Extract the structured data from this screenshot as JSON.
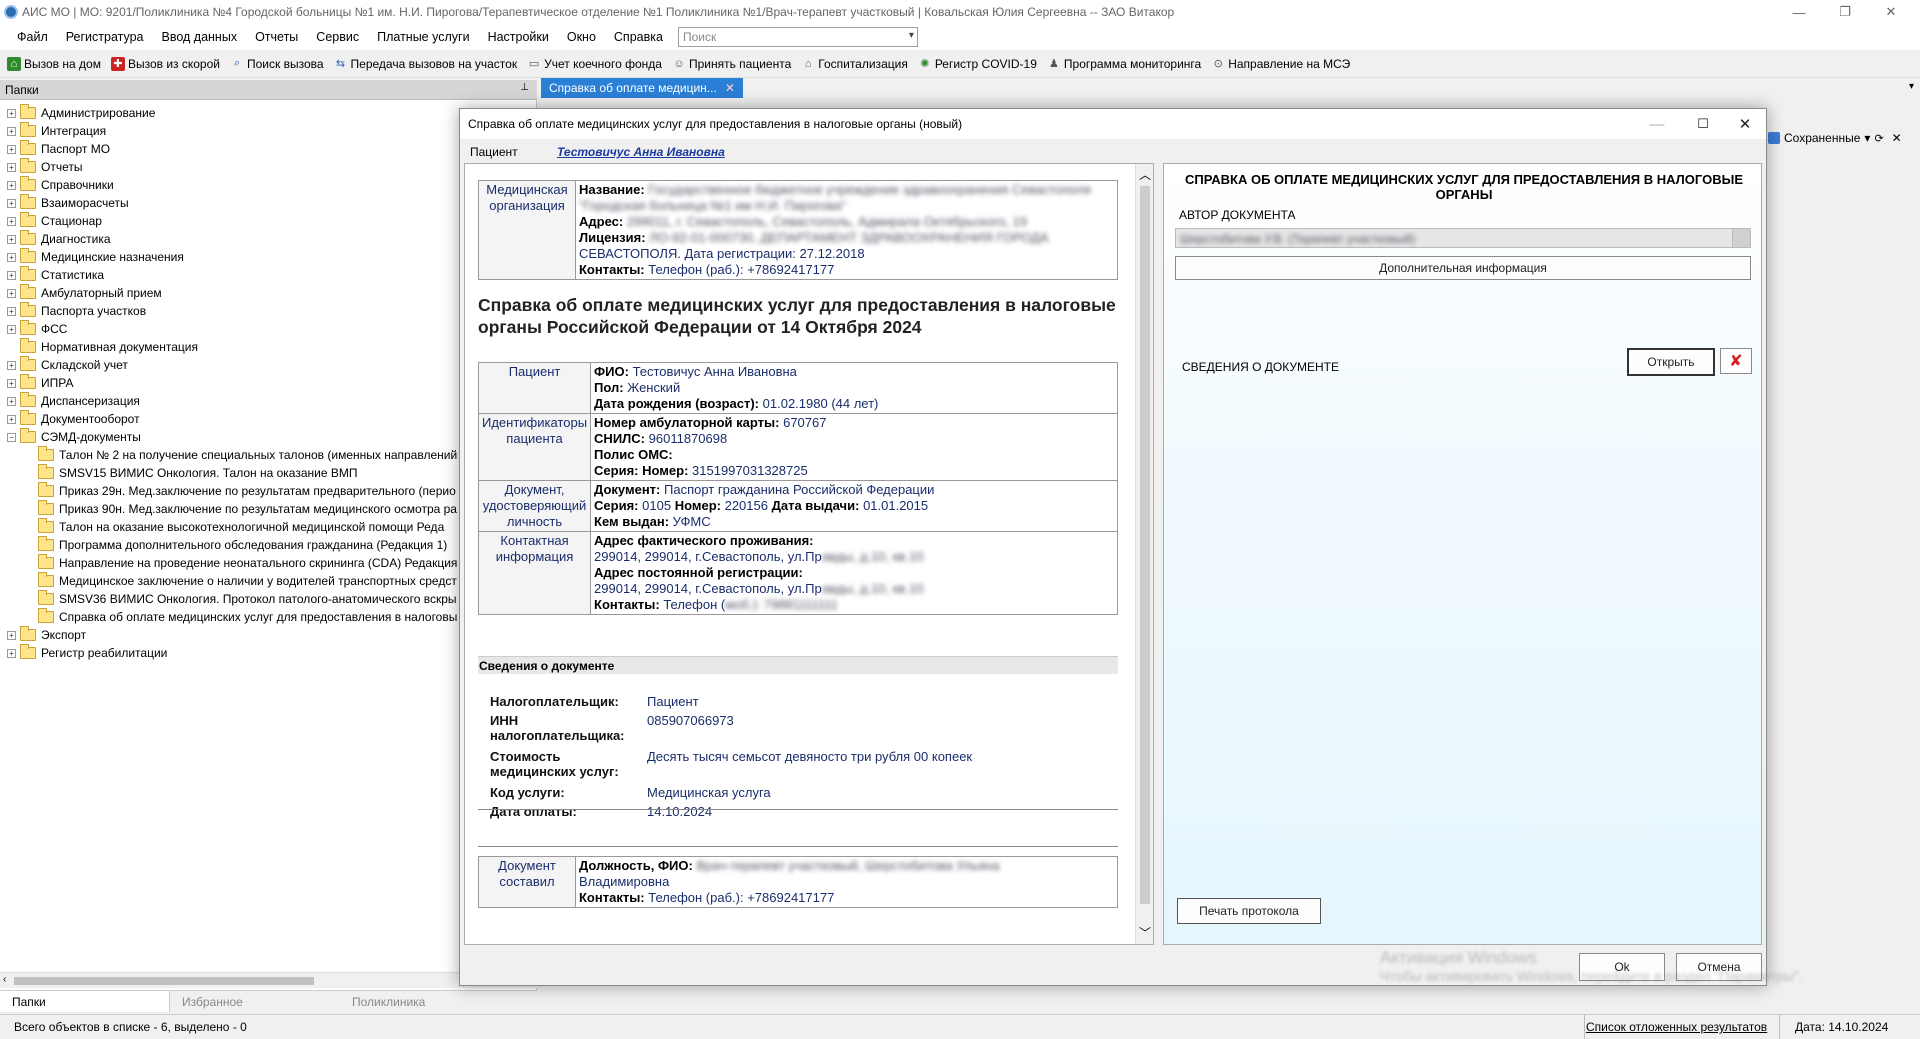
{
  "window": {
    "title": "АИС МО | МО: 9201/Поликлиника №4 Городской больницы №1 им. Н.И. Пирогова/Терапевтическое отделение №1 Поликлиника №1/Врач-терапевт участковый | Ковальская Юлия Сергеевна -- ЗАО Витакор"
  },
  "menu": [
    "Файл",
    "Регистратура",
    "Ввод данных",
    "Отчеты",
    "Сервис",
    "Платные услуги",
    "Настройки",
    "Окно",
    "Справка"
  ],
  "search": {
    "placeholder": "Поиск"
  },
  "toolbar": [
    {
      "label": "Вызов на дом",
      "icon": "house-icon",
      "color": "#2e8b2e"
    },
    {
      "label": "Вызов из скорой",
      "icon": "ambulance-icon",
      "color": "#cc2222"
    },
    {
      "label": "Поиск вызова",
      "icon": "search-icon",
      "color": "#2b5fb0"
    },
    {
      "label": "Передача вызовов на участок",
      "icon": "transfer-icon",
      "color": "#2b5fb0"
    },
    {
      "label": "Учет коечного фонда",
      "icon": "bed-icon",
      "color": "#555555"
    },
    {
      "label": "Принять пациента",
      "icon": "patient-icon",
      "color": "#555555"
    },
    {
      "label": "Госпитализация",
      "icon": "hospital-icon",
      "color": "#555555"
    },
    {
      "label": "Регистр COVID-19",
      "icon": "virus-icon",
      "color": "#2e8b2e"
    },
    {
      "label": "Программа мониторинга",
      "icon": "monitor-icon",
      "color": "#555555"
    },
    {
      "label": "Направление на МСЭ",
      "icon": "referral-icon",
      "color": "#555555"
    }
  ],
  "left_panel": {
    "header": "Папки",
    "pin": "📌",
    "tree": [
      {
        "label": "Администрирование",
        "level": 0,
        "expander": "+"
      },
      {
        "label": "Интеграция",
        "level": 0,
        "expander": "+"
      },
      {
        "label": "Паспорт МО",
        "level": 0,
        "expander": "+"
      },
      {
        "label": "Отчеты",
        "level": 0,
        "expander": "+"
      },
      {
        "label": "Справочники",
        "level": 0,
        "expander": "+"
      },
      {
        "label": "Взаиморасчеты",
        "level": 0,
        "expander": "+"
      },
      {
        "label": "Стационар",
        "level": 0,
        "expander": "+"
      },
      {
        "label": "Диагностика",
        "level": 0,
        "expander": "+"
      },
      {
        "label": "Медицинские назначения",
        "level": 0,
        "expander": "+"
      },
      {
        "label": "Статистика",
        "level": 0,
        "expander": "+"
      },
      {
        "label": "Амбулаторный прием",
        "level": 0,
        "expander": "+"
      },
      {
        "label": "Паспорта участков",
        "level": 0,
        "expander": "+"
      },
      {
        "label": "ФСС",
        "level": 0,
        "expander": "+"
      },
      {
        "label": "Нормативная документация",
        "level": 0,
        "expander": ""
      },
      {
        "label": "Складской учет",
        "level": 0,
        "expander": "+"
      },
      {
        "label": "ИПРА",
        "level": 0,
        "expander": "+"
      },
      {
        "label": "Диспансеризация",
        "level": 0,
        "expander": "+"
      },
      {
        "label": "Документооборот",
        "level": 0,
        "expander": "+"
      },
      {
        "label": "СЭМД-документы",
        "level": 0,
        "expander": "−"
      },
      {
        "label": "Талон № 2 на получение специальных талонов (именных направлений",
        "level": 1,
        "expander": ""
      },
      {
        "label": "SMSV15 ВИМИС Онкология. Талон на оказание ВМП",
        "level": 1,
        "expander": ""
      },
      {
        "label": "Приказ 29н. Мед.заключение по результатам предварительного (перио",
        "level": 1,
        "expander": ""
      },
      {
        "label": "Приказ 90н. Мед.заключение по результатам медицинского осмотра ра",
        "level": 1,
        "expander": ""
      },
      {
        "label": "Талон на оказание высокотехнологичной медицинской помощи Реда",
        "level": 1,
        "expander": ""
      },
      {
        "label": "Программа дополнительного обследования гражданина (Редакция 1)",
        "level": 1,
        "expander": ""
      },
      {
        "label": "Направление на проведение неонатального скрининга (CDA) Редакция",
        "level": 1,
        "expander": ""
      },
      {
        "label": "Медицинское заключение о наличии у водителей транспортных средст",
        "level": 1,
        "expander": ""
      },
      {
        "label": "SMSV36 ВИМИС Онкология. Протокол патолого-анатомического вскры",
        "level": 1,
        "expander": ""
      },
      {
        "label": "Справка об оплате медицинских услуг для предоставления в налоговы",
        "level": 1,
        "expander": ""
      },
      {
        "label": "Экспорт",
        "level": 0,
        "expander": "+"
      },
      {
        "label": "Регистр реабилитации",
        "level": 0,
        "expander": "+"
      }
    ],
    "tabs": [
      "Папки",
      "Избранное",
      "Поликлиника"
    ]
  },
  "doc_tab": {
    "label": "Справка об оплате медицин...",
    "close": "✕"
  },
  "saved": {
    "label": "Сохраненные",
    "arrow": "▾",
    "close": "✕"
  },
  "dialog": {
    "title": "Справка об оплате медицинских услуг для предоставления в налоговые органы (новый)",
    "patient_label": "Пациент",
    "patient_name": "Тестовичус Анна Ивановна",
    "org": {
      "label": "Медицинская организация",
      "name_k": "Название:",
      "name_v": "Государственное бюджетное учреждение здравоохранения Севастополя \"Городская больница №1 им Н.И. Пирогова\"",
      "addr_k": "Адрес:",
      "addr_v": "299011, г. Севастополь, Севастополь, Адмирала Октябрьского, 19",
      "lic_k": "Лицензия:",
      "lic_v1": "ЛО-92-01-000730, ДЕПАРТАМЕНТ ЗДРАВООХРАНЕНИЯ ГОРОДА",
      "lic_v2": "СЕВАСТОПОЛЯ. Дата регистрации: 27.12.2018",
      "cont_k": "Контакты:",
      "cont_v": "Телефон (раб.): +78692417177"
    },
    "heading": "Справка об оплате медицинских услуг для предоставления в налоговые органы Российской Федерации от 14 Октября 2024",
    "patient_sec": {
      "label": "Пациент",
      "fio_k": "ФИО:",
      "fio_v": "Тестовичус Анна Ивановна",
      "sex_k": "Пол:",
      "sex_v": "Женский",
      "dob_k": "Дата рождения (возраст):",
      "dob_v": "01.02.1980 (44 лет)"
    },
    "ids_sec": {
      "label": "Идентификаторы пациента",
      "card_k": "Номер амбулаторной карты:",
      "card_v": "670767",
      "snils_k": "СНИЛС:",
      "snils_v": "96011870698",
      "oms_k": "Полис ОМС:",
      "ser_k": "Серия: Номер:",
      "ser_v": "3151997031328725"
    },
    "doc_sec": {
      "label": "Документ, удостоверяющий личность",
      "doc_k": "Документ:",
      "doc_v": "Паспорт гражданина Российской Федерации",
      "ser_k": "Серия:",
      "ser_v": "0105",
      "num_k": "Номер:",
      "num_v": "220156",
      "date_k": "Дата выдачи:",
      "date_v": "01.01.2015",
      "iss_k": "Кем выдан:",
      "iss_v": "УФМС"
    },
    "contact_sec": {
      "label": "Контактная информация",
      "fact_k": "Адрес фактического проживания:",
      "fact_v1": "299014, 299014, г.Севастополь, ул.Пр",
      "fact_v2": "авды, д.10, кв.10",
      "reg_k": "Адрес постоянной регистрации:",
      "reg_v1": "299014, 299014, г.Севастополь, ул.Пр",
      "reg_v2": "авды, д.10, кв.10",
      "cont_k": "Контакты:",
      "cont_v1": "Телефон (",
      "cont_v2": "моб.): 79881111111"
    },
    "details_header": "Сведения о документе",
    "details": [
      {
        "k": "Налогоплательщик:",
        "v": "Пациент"
      },
      {
        "k": "ИНН налогоплательщика:",
        "v": "085907066973"
      },
      {
        "k": "Стоимость медицинских услуг:",
        "v": "Десять тысяч семьсот девяносто три рубля 00 копеек"
      },
      {
        "k": "Код услуги:",
        "v": "Медицинская услуга"
      },
      {
        "k": "Дата оплаты:",
        "v": "14.10.2024"
      }
    ],
    "author_sec": {
      "label": "Документ составил",
      "k": "Должность, ФИО:",
      "v1": "Врач-терапевт участковый, Шерстобитова Ульяна",
      "v2": "Владимировна",
      "cont_k": "Контакты:",
      "cont_v": "Телефон (раб.): +78692417177"
    },
    "right": {
      "title": "СПРАВКА ОБ ОПЛАТЕ МЕДИЦИНСКИХ УСЛУГ ДЛЯ ПРЕДОСТАВЛЕНИЯ В НАЛОГОВЫЕ ОРГАНЫ",
      "author_label": "АВТОР ДОКУМЕНТА",
      "author_value": "Шерстобитова У.В. (Терапевт участковый)",
      "more_info": "Дополнительная информация",
      "doc_info": "СВЕДЕНИЯ О ДОКУМЕНТЕ",
      "open": "Открыть",
      "print": "Печать протокола"
    },
    "ok": "Ok",
    "cancel": "Отмена"
  },
  "watermark": {
    "line1": "Активация Windows",
    "line2": "Чтобы активировать Windows, перейдите в раздел \"Параметры\"."
  },
  "status": {
    "left": "Всего объектов в списке - 6, выделено - 0",
    "deferred": "Список отложенных результатов",
    "date": "Дата: 14.10.2024"
  }
}
